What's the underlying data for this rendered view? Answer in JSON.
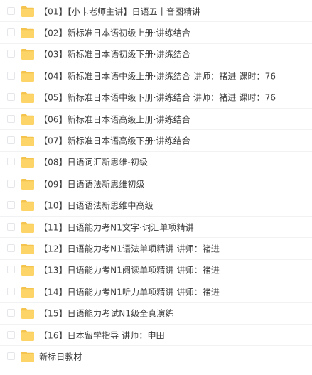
{
  "icons": {
    "folder": "folder-icon",
    "folder_color": "#fcd467",
    "folder_tab_color": "#f5c44e"
  },
  "files": [
    {
      "name": "【01】【小卡老师主讲】日语五十音图精讲"
    },
    {
      "name": "【02】新标准日本语初级上册·讲练结合"
    },
    {
      "name": "【03】新标准日本语初级下册·讲练结合"
    },
    {
      "name": "【04】新标准日本语中级上册·讲练结合 讲师：褚进 课时：76"
    },
    {
      "name": "【05】新标准日本语中级下册·讲练结合 讲师：褚进 课时：76"
    },
    {
      "name": "【06】新标准日本语高级上册·讲练结合"
    },
    {
      "name": "【07】新标准日本语高级下册·讲练结合"
    },
    {
      "name": "【08】日语词汇新思维-初级"
    },
    {
      "name": "【09】日语语法新思维初级"
    },
    {
      "name": "【10】日语语法新思维中高级"
    },
    {
      "name": "【11】日语能力考N1文字·词汇单项精讲"
    },
    {
      "name": "【12】日语能力考N1语法单项精讲 讲师：褚进"
    },
    {
      "name": "【13】日语能力考N1阅读单项精讲 讲师：褚进"
    },
    {
      "name": "【14】日语能力考N1听力单项精讲 讲师：褚进"
    },
    {
      "name": "【15】日语能力考试N1级全真演练"
    },
    {
      "name": "【16】日本留学指导 讲师：申田"
    },
    {
      "name": "新标日教材"
    }
  ]
}
